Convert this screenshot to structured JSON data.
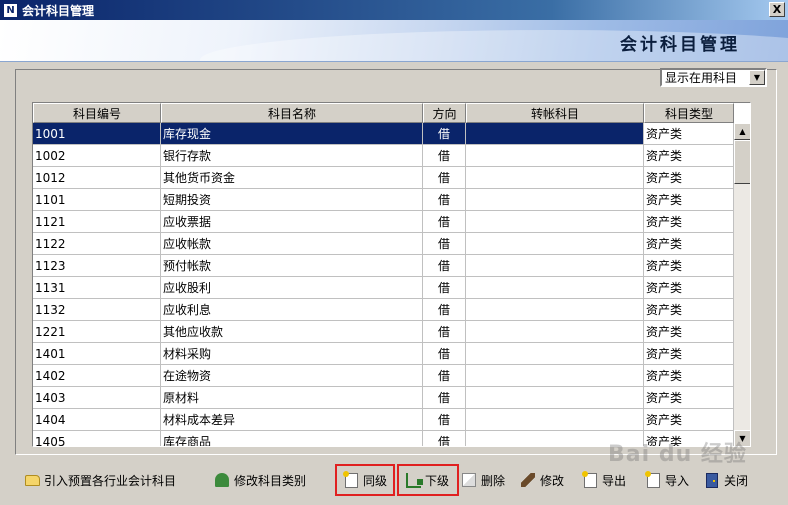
{
  "window": {
    "title": "会计科目管理",
    "close_label": "X"
  },
  "banner": {
    "title": "会计科目管理"
  },
  "filter": {
    "selected": "显示在用科目"
  },
  "table": {
    "columns": [
      "科目编号",
      "科目名称",
      "方向",
      "转帐科目",
      "科目类型"
    ],
    "rows": [
      {
        "code": "1001",
        "name": "库存现金",
        "dir": "借",
        "transfer": "",
        "type": "资产类"
      },
      {
        "code": "1002",
        "name": "银行存款",
        "dir": "借",
        "transfer": "",
        "type": "资产类"
      },
      {
        "code": "1012",
        "name": "其他货币资金",
        "dir": "借",
        "transfer": "",
        "type": "资产类"
      },
      {
        "code": "1101",
        "name": "短期投资",
        "dir": "借",
        "transfer": "",
        "type": "资产类"
      },
      {
        "code": "1121",
        "name": "应收票据",
        "dir": "借",
        "transfer": "",
        "type": "资产类"
      },
      {
        "code": "1122",
        "name": "应收帐款",
        "dir": "借",
        "transfer": "",
        "type": "资产类"
      },
      {
        "code": "1123",
        "name": "预付帐款",
        "dir": "借",
        "transfer": "",
        "type": "资产类"
      },
      {
        "code": "1131",
        "name": "应收股利",
        "dir": "借",
        "transfer": "",
        "type": "资产类"
      },
      {
        "code": "1132",
        "name": "应收利息",
        "dir": "借",
        "transfer": "",
        "type": "资产类"
      },
      {
        "code": "1221",
        "name": "其他应收款",
        "dir": "借",
        "transfer": "",
        "type": "资产类"
      },
      {
        "code": "1401",
        "name": "材料采购",
        "dir": "借",
        "transfer": "",
        "type": "资产类"
      },
      {
        "code": "1402",
        "name": "在途物资",
        "dir": "借",
        "transfer": "",
        "type": "资产类"
      },
      {
        "code": "1403",
        "name": "原材料",
        "dir": "借",
        "transfer": "",
        "type": "资产类"
      },
      {
        "code": "1404",
        "name": "材料成本差异",
        "dir": "借",
        "transfer": "",
        "type": "资产类"
      },
      {
        "code": "1405",
        "name": "库存商品",
        "dir": "借",
        "transfer": "",
        "type": "资产类"
      }
    ]
  },
  "toolbar": {
    "import": "引入预置各行业会计科目",
    "edit_category": "修改科目类别",
    "sibling": "同级",
    "child": "下级",
    "delete": "删除",
    "modify": "修改",
    "export": "导出",
    "import_file": "导入",
    "close": "关闭"
  },
  "watermark": {
    "text": "Bai du 经验"
  }
}
